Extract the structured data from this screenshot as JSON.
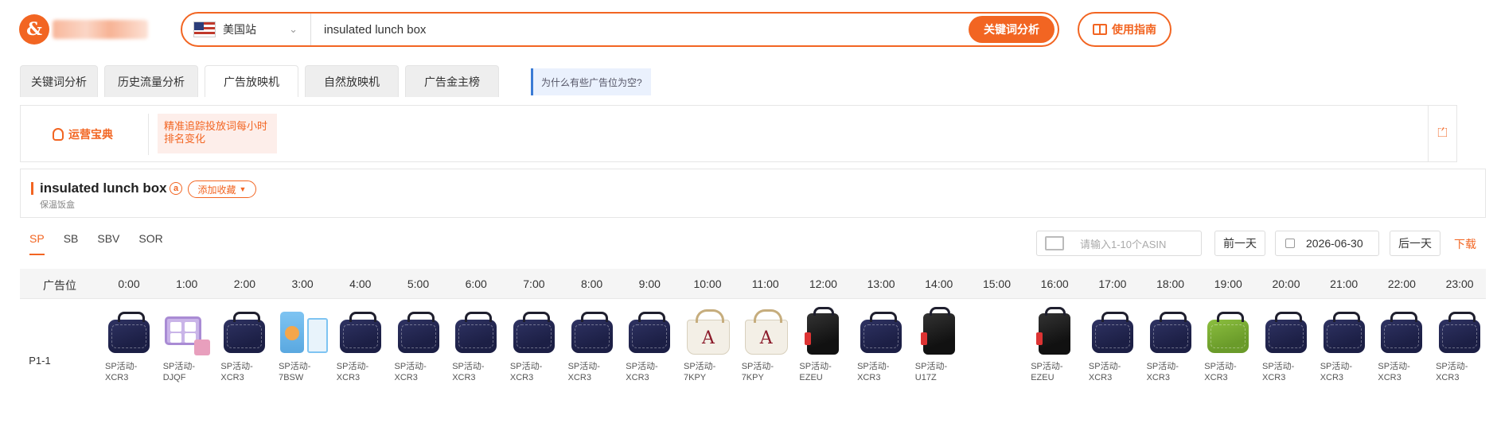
{
  "header": {
    "site_label": "美国站",
    "search_value": "insulated lunch box",
    "search_button": "关键词分析",
    "guide_button": "使用指南"
  },
  "tabs": [
    {
      "label": "关键词分析"
    },
    {
      "label": "历史流量分析"
    },
    {
      "label": "广告放映机"
    },
    {
      "label": "自然放映机"
    },
    {
      "label": "广告金主榜"
    }
  ],
  "tab_help": "为什么有些广告位为空?",
  "tip": {
    "title": "运营宝典",
    "line1": "精准追踪投放词每小时",
    "line2": "排名变化"
  },
  "keyword": {
    "title": "insulated lunch box",
    "amazon_badge": "a",
    "favorite_label": "添加收藏",
    "translation": "保温饭盒"
  },
  "ad_tabs": [
    {
      "label": "SP"
    },
    {
      "label": "SB"
    },
    {
      "label": "SBV"
    },
    {
      "label": "SOR"
    }
  ],
  "controls": {
    "asin_placeholder": "请输入1-10个ASIN",
    "prev_day": "前一天",
    "date": "2026-06-30",
    "next_day": "后一天",
    "download": "下载"
  },
  "table": {
    "position_header": "广告位",
    "hours": [
      "0:00",
      "1:00",
      "2:00",
      "3:00",
      "4:00",
      "5:00",
      "6:00",
      "7:00",
      "8:00",
      "9:00",
      "10:00",
      "11:00",
      "12:00",
      "13:00",
      "14:00",
      "15:00",
      "16:00",
      "17:00",
      "18:00",
      "19:00",
      "20:00",
      "21:00",
      "22:00",
      "23:00"
    ],
    "row_label": "P1-1",
    "cells": [
      {
        "hour": "0:00",
        "line1": "SP活动-",
        "line2": "XCR3",
        "product": "navy-lunch-bag"
      },
      {
        "hour": "1:00",
        "line1": "SP活动-",
        "line2": "DJQF",
        "product": "purple-bento-box"
      },
      {
        "hour": "2:00",
        "line1": "SP活动-",
        "line2": "XCR3",
        "product": "navy-lunch-bag"
      },
      {
        "hour": "3:00",
        "line1": "SP活动-",
        "line2": "7BSW",
        "product": "kids-lunch-set"
      },
      {
        "hour": "4:00",
        "line1": "SP活动-",
        "line2": "XCR3",
        "product": "navy-lunch-bag"
      },
      {
        "hour": "5:00",
        "line1": "SP活动-",
        "line2": "XCR3",
        "product": "navy-lunch-bag"
      },
      {
        "hour": "6:00",
        "line1": "SP活动-",
        "line2": "XCR3",
        "product": "navy-lunch-bag"
      },
      {
        "hour": "7:00",
        "line1": "SP活动-",
        "line2": "XCR3",
        "product": "navy-lunch-bag"
      },
      {
        "hour": "8:00",
        "line1": "SP活动-",
        "line2": "XCR3",
        "product": "navy-lunch-bag"
      },
      {
        "hour": "9:00",
        "line1": "SP活动-",
        "line2": "XCR3",
        "product": "navy-lunch-bag"
      },
      {
        "hour": "10:00",
        "line1": "SP活动-",
        "line2": "7KPY",
        "product": "monogram-tote-bag"
      },
      {
        "hour": "11:00",
        "line1": "SP活动-",
        "line2": "7KPY",
        "product": "monogram-tote-bag"
      },
      {
        "hour": "12:00",
        "line1": "SP活动-",
        "line2": "EZEU",
        "product": "black-lunch-bag"
      },
      {
        "hour": "13:00",
        "line1": "SP活动-",
        "line2": "XCR3",
        "product": "navy-lunch-bag"
      },
      {
        "hour": "14:00",
        "line1": "SP活动-",
        "line2": "U17Z",
        "product": "black-lunch-bag"
      },
      {
        "hour": "15:00",
        "line1": "",
        "line2": "",
        "product": "empty"
      },
      {
        "hour": "16:00",
        "line1": "SP活动-",
        "line2": "EZEU",
        "product": "black-lunch-bag"
      },
      {
        "hour": "17:00",
        "line1": "SP活动-",
        "line2": "XCR3",
        "product": "navy-lunch-bag"
      },
      {
        "hour": "18:00",
        "line1": "SP活动-",
        "line2": "XCR3",
        "product": "navy-lunch-bag"
      },
      {
        "hour": "19:00",
        "line1": "SP活动-",
        "line2": "XCR3",
        "product": "green-lunch-bag"
      },
      {
        "hour": "20:00",
        "line1": "SP活动-",
        "line2": "XCR3",
        "product": "navy-lunch-bag"
      },
      {
        "hour": "21:00",
        "line1": "SP活动-",
        "line2": "XCR3",
        "product": "navy-lunch-bag"
      },
      {
        "hour": "22:00",
        "line1": "SP活动-",
        "line2": "XCR3",
        "product": "navy-lunch-bag"
      },
      {
        "hour": "23:00",
        "line1": "SP活动-",
        "line2": "XCR3",
        "product": "navy-lunch-bag"
      }
    ]
  },
  "colors": {
    "accent": "#f26522",
    "help_accent": "#3a7bd5"
  }
}
